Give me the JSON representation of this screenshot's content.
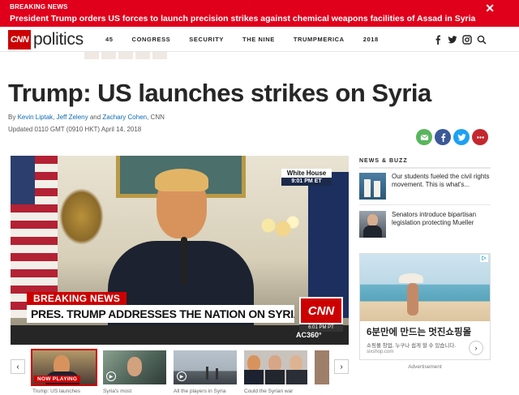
{
  "breaking": {
    "kicker": "BREAKING NEWS",
    "headline": "President Trump orders US forces to launch precision strikes against chemical weapons facilities of Assad in Syria",
    "close_glyph": "✕"
  },
  "nav": {
    "logo_cnn": "CNN",
    "logo_section": "politics",
    "links": [
      "45",
      "CONGRESS",
      "SECURITY",
      "THE NINE",
      "TRUMPMERICA",
      "2018"
    ],
    "icons": [
      "facebook-icon",
      "twitter-icon",
      "instagram-icon",
      "search-icon"
    ]
  },
  "article": {
    "title": "Trump: US launches strikes on Syria",
    "byline_prefix": "By ",
    "authors": [
      "Kevin Liptak",
      "Jeff Zeleny",
      "Zachary Cohen"
    ],
    "byline_sep1": ", ",
    "byline_sep2": " and ",
    "byline_suffix": ", CNN",
    "updated": "Updated 0110 GMT (0910 HKT) April 14, 2018"
  },
  "share": [
    {
      "name": "email-share-icon",
      "color": "#5ab55e"
    },
    {
      "name": "facebook-share-icon",
      "color": "#3b5998"
    },
    {
      "name": "twitter-share-icon",
      "color": "#1da1f2"
    },
    {
      "name": "more-share-icon",
      "color": "#c4262e"
    }
  ],
  "video": {
    "breaking_label": "BREAKING NEWS",
    "lower_third": "PRES. TRUMP ADDRESSES THE NATION ON SYRIA",
    "badge_location": "White House",
    "badge_time": "9:01 PM ET",
    "bug_logo": "CNN",
    "bug_time": "6:01 PM PT",
    "show": "AC360°"
  },
  "carousel": {
    "prev_glyph": "‹",
    "next_glyph": "›",
    "items": [
      {
        "caption": "Trump: US launches",
        "now_playing": "NOW PLAYING"
      },
      {
        "caption": "Syria's most"
      },
      {
        "caption": "All the players in Syria"
      },
      {
        "caption": "Could the Syrian war"
      },
      {
        "caption": ""
      }
    ]
  },
  "sidebar": {
    "heading": "NEWS & BUZZ",
    "items": [
      {
        "text": "Our students fueled the civil rights movement. This is what's..."
      },
      {
        "text": "Senators introduce bipartisan legislation protecting Mueller"
      }
    ]
  },
  "ad": {
    "title": "6분만에 만드는 멋진쇼핑몰",
    "sub": "쇼핑몰 창업, 누구나 쉽게 할 수 있습니다.",
    "domain": "sixshop.com",
    "arrow_glyph": "›",
    "label": "Advertisement",
    "adchoice": "▷"
  }
}
